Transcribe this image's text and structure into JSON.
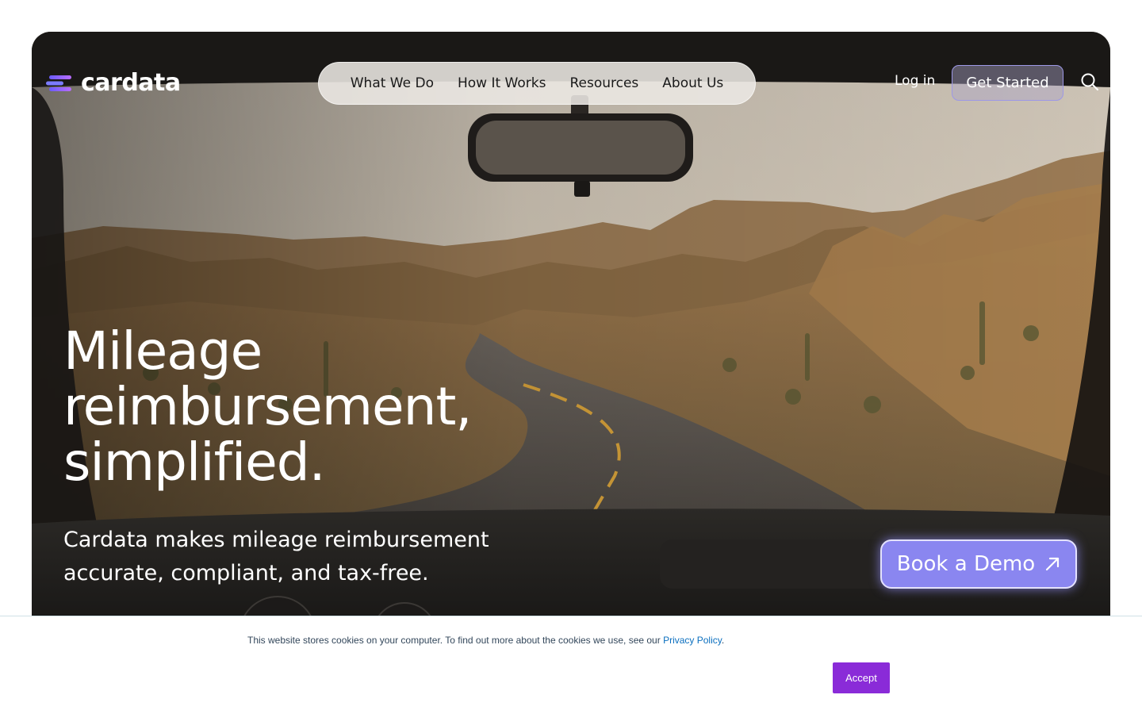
{
  "brand": {
    "name": "cardata",
    "logo_icon": "cardata-logo-mark"
  },
  "nav": {
    "items": [
      {
        "label": "What We Do"
      },
      {
        "label": "How It Works"
      },
      {
        "label": "Resources"
      },
      {
        "label": "About Us"
      }
    ],
    "login_label": "Log in",
    "cta_label": "Get Started",
    "search_icon": "search-icon"
  },
  "hero": {
    "headline_lines": [
      "Mileage",
      "reimbursement,",
      "simplified."
    ],
    "subhead_lines": [
      "Cardata makes mileage reimbursement",
      "accurate, compliant, and tax-free."
    ],
    "demo_label": "Book a Demo",
    "demo_icon": "arrow-up-right-icon",
    "background_image": "desert-road-through-windshield"
  },
  "cookie_banner": {
    "text": "This website stores cookies on your computer. To find out more about the cookies we use, see our ",
    "link_label": "Privacy Policy",
    "suffix": ".",
    "accept_label": "Accept"
  },
  "colors": {
    "accent": "#8a86f0",
    "accept_button": "#8a2bd8",
    "link": "#0b6fbf",
    "banner_text": "#33475b"
  }
}
